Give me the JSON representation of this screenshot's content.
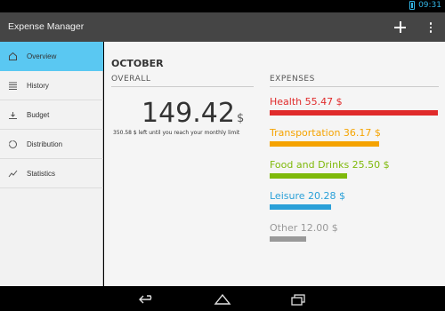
{
  "status_bar": {
    "time": "09:31",
    "battery_icon": "battery-icon"
  },
  "action_bar": {
    "title": "Expense Manager",
    "add_icon": "add-icon",
    "overflow_icon": "overflow-menu-icon"
  },
  "sidebar": {
    "items": [
      {
        "label": "Overview",
        "icon": "home-icon",
        "active": true
      },
      {
        "label": "History",
        "icon": "list-icon",
        "active": false
      },
      {
        "label": "Budget",
        "icon": "budget-icon",
        "active": false
      },
      {
        "label": "Distribution",
        "icon": "pie-chart-icon",
        "active": false
      },
      {
        "label": "Statistics",
        "icon": "line-chart-icon",
        "active": false
      }
    ]
  },
  "main": {
    "month": "OCTOBER",
    "overall_label": "OVERALL",
    "amount": "149.42",
    "currency": "$",
    "remaining_text": "350.58 $ left until you reach your monthly limit",
    "expenses_label": "EXPENSES",
    "expenses": [
      {
        "label": "Health 55.47 $",
        "color": "#e02b2b",
        "share": 1.0
      },
      {
        "label": "Transportation 36.17 $",
        "color": "#f5a300",
        "share": 0.652
      },
      {
        "label": "Food and Drinks 25.50 $",
        "color": "#7fb90a",
        "share": 0.46
      },
      {
        "label": "Leisure 20.28 $",
        "color": "#2aa0d8",
        "share": 0.366
      },
      {
        "label": "Other 12.00 $",
        "color": "#999999",
        "share": 0.216
      }
    ]
  },
  "nav_bar": {
    "back_icon": "back-icon",
    "home_icon": "home-nav-icon",
    "recent_icon": "recent-apps-icon"
  }
}
